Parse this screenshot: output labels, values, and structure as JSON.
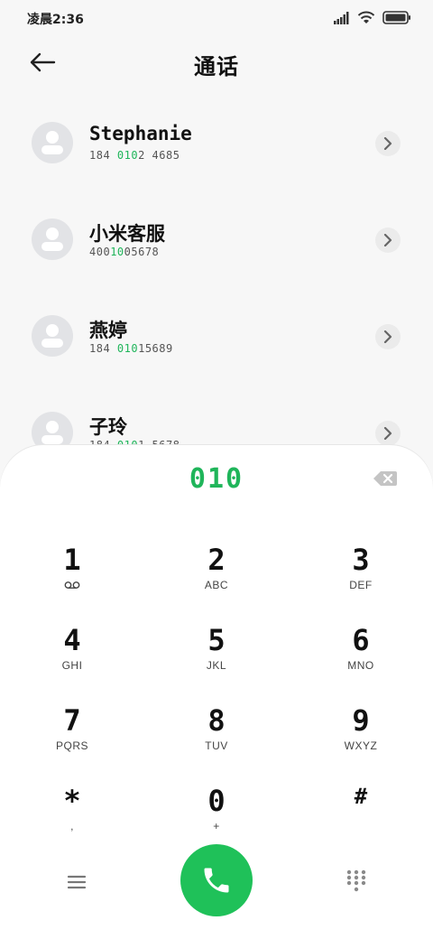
{
  "status_bar": {
    "time": "凌晨2:36",
    "icons": [
      "signal-icon",
      "wifi-icon",
      "battery-icon"
    ]
  },
  "header": {
    "title": "通话",
    "back_icon": "arrow-left-icon"
  },
  "contacts": [
    {
      "name": "Stephanie",
      "number_parts": [
        "184 ",
        "010",
        "2 4685"
      ]
    },
    {
      "name": "小米客服",
      "number_parts": [
        "400",
        "10",
        "05678"
      ]
    },
    {
      "name": "燕婷",
      "number_parts": [
        "184 ",
        "010",
        "15689"
      ]
    },
    {
      "name": "子玲",
      "number_parts": [
        "184 ",
        "010",
        "1 5678"
      ]
    }
  ],
  "dialpad": {
    "dialed": "010",
    "keys": [
      {
        "digit": "1",
        "letters": "ꝏ"
      },
      {
        "digit": "2",
        "letters": "ABC"
      },
      {
        "digit": "3",
        "letters": "DEF"
      },
      {
        "digit": "4",
        "letters": "GHI"
      },
      {
        "digit": "5",
        "letters": "JKL"
      },
      {
        "digit": "6",
        "letters": "MNO"
      },
      {
        "digit": "7",
        "letters": "PQRS"
      },
      {
        "digit": "8",
        "letters": "TUV"
      },
      {
        "digit": "9",
        "letters": "WXYZ"
      },
      {
        "digit": "*",
        "letters": ","
      },
      {
        "digit": "0",
        "letters": "+"
      },
      {
        "digit": "#",
        "letters": ""
      }
    ]
  },
  "colors": {
    "accent": "#1fc159",
    "highlight": "#1fb55a"
  }
}
